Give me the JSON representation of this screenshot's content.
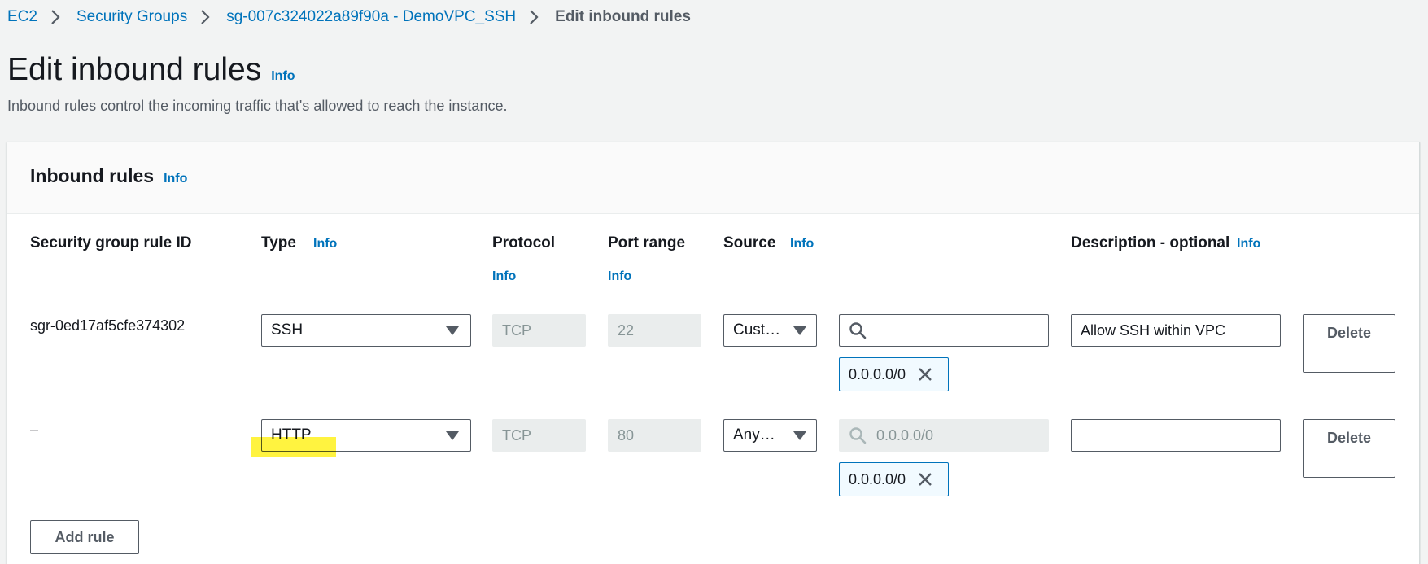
{
  "breadcrumb": {
    "items": [
      "EC2",
      "Security Groups",
      "sg-007c324022a89f90a - DemoVPC_SSH"
    ],
    "current": "Edit inbound rules"
  },
  "page": {
    "title": "Edit inbound rules",
    "info_label": "Info",
    "description": "Inbound rules control the incoming traffic that's allowed to reach the instance."
  },
  "panel": {
    "title": "Inbound rules",
    "info_label": "Info",
    "columns": {
      "rule_id": "Security group rule ID",
      "type": "Type",
      "type_info": "Info",
      "protocol": "Protocol",
      "protocol_info": "Info",
      "port_range": "Port range",
      "port_range_info": "Info",
      "source": "Source",
      "source_info": "Info",
      "description": "Description - optional",
      "description_info": "Info"
    },
    "rows": [
      {
        "rule_id": "sgr-0ed17af5cfe374302",
        "type": "SSH",
        "protocol": "TCP",
        "port_range": "22",
        "source_type": "Cust…",
        "source_search_value": "",
        "source_token": "0.0.0.0/0",
        "description": "Allow SSH within VPC",
        "delete_label": "Delete"
      },
      {
        "rule_id": "–",
        "type": "HTTP",
        "protocol": "TCP",
        "port_range": "80",
        "source_type": "Any…",
        "source_search_value": "0.0.0.0/0",
        "source_token": "0.0.0.0/0",
        "description": "",
        "delete_label": "Delete"
      }
    ],
    "add_rule_label": "Add rule"
  },
  "colors": {
    "link": "#0073bb",
    "background": "#f2f3f3",
    "highlight": "#ffef00"
  },
  "icons": [
    "chevron-right-icon",
    "caret-down-icon",
    "search-icon",
    "close-icon"
  ]
}
